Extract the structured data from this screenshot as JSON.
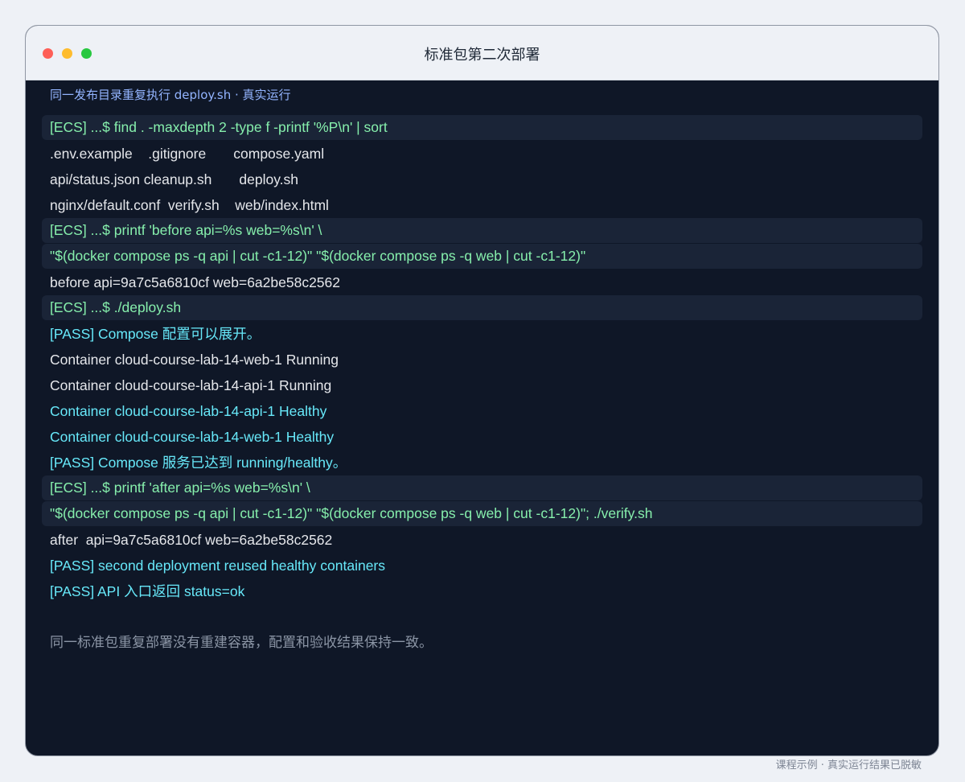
{
  "window": {
    "title": "标准包第二次部署"
  },
  "terminal": {
    "subtitle": "同一发布目录重复执行 deploy.sh · 真实运行",
    "lines": [
      {
        "kind": "cmd",
        "text": "[ECS] ...$ find . -maxdepth 2 -type f -printf '%P\\n' | sort"
      },
      {
        "kind": "out",
        "text": ".env.example    .gitignore       compose.yaml"
      },
      {
        "kind": "out",
        "text": "api/status.json cleanup.sh       deploy.sh"
      },
      {
        "kind": "out",
        "text": "nginx/default.conf  verify.sh    web/index.html"
      },
      {
        "kind": "cmd",
        "text": "[ECS] ...$ printf 'before api=%s web=%s\\n' \\"
      },
      {
        "kind": "cmd",
        "text": "\"$(docker compose ps -q api | cut -c1-12)\" \"$(docker compose ps -q web | cut -c1-12)\""
      },
      {
        "kind": "out",
        "text": "before api=9a7c5a6810cf web=6a2be58c2562"
      },
      {
        "kind": "cmd",
        "text": "[ECS] ...$ ./deploy.sh"
      },
      {
        "kind": "pass",
        "text": "[PASS] Compose 配置可以展开。"
      },
      {
        "kind": "out",
        "text": "Container cloud-course-lab-14-web-1 Running"
      },
      {
        "kind": "out",
        "text": "Container cloud-course-lab-14-api-1 Running"
      },
      {
        "kind": "pass",
        "text": "Container cloud-course-lab-14-api-1 Healthy"
      },
      {
        "kind": "pass",
        "text": "Container cloud-course-lab-14-web-1 Healthy"
      },
      {
        "kind": "pass",
        "text": "[PASS] Compose 服务已达到 running/healthy。"
      },
      {
        "kind": "cmd",
        "text": "[ECS] ...$ printf 'after api=%s web=%s\\n' \\"
      },
      {
        "kind": "cmd",
        "text": "\"$(docker compose ps -q api | cut -c1-12)\" \"$(docker compose ps -q web | cut -c1-12)\"; ./verify.sh"
      },
      {
        "kind": "out",
        "text": "after  api=9a7c5a6810cf web=6a2be58c2562"
      },
      {
        "kind": "pass",
        "text": "[PASS] second deployment reused healthy containers"
      },
      {
        "kind": "pass",
        "text": "[PASS] API 入口返回 status=ok"
      }
    ],
    "summary": "同一标准包重复部署没有重建容器，配置和验收结果保持一致。"
  },
  "caption": "课程示例 · 真实运行结果已脱敏",
  "colors": {
    "background": "#eef1f6",
    "terminal_bg": "#0f1727",
    "command_bg": "#1a2437",
    "command_text": "#86efac",
    "output_text": "#e5e7eb",
    "pass_text": "#67e8f9",
    "subtitle_text": "#93b4ff"
  }
}
